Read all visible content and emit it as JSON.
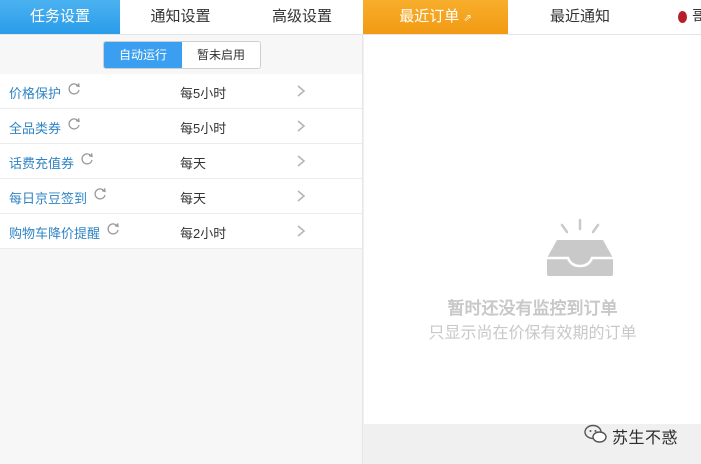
{
  "tabs": [
    {
      "label": "任务设置",
      "state": "active"
    },
    {
      "label": "通知设置",
      "state": "normal"
    },
    {
      "label": "高级设置",
      "state": "normal"
    },
    {
      "label": "最近订单",
      "state": "highlight",
      "icon": "external-link-icon"
    },
    {
      "label": "最近通知",
      "state": "normal"
    },
    {
      "label": "哥",
      "state": "clipped",
      "icon": "red-dot-icon"
    }
  ],
  "mode_toggle": {
    "options": [
      "自动运行",
      "暂未启用"
    ],
    "selected": "自动运行"
  },
  "tasks": [
    {
      "name": "价格保护",
      "frequency": "每5小时",
      "icon": "refresh-icon"
    },
    {
      "name": "全品类券",
      "frequency": "每5小时",
      "icon": "refresh-icon"
    },
    {
      "name": "话费充值券",
      "frequency": "每天",
      "icon": "refresh-icon"
    },
    {
      "name": "每日京豆签到",
      "frequency": "每天",
      "icon": "refresh-icon"
    },
    {
      "name": "购物车降价提醒",
      "frequency": "每2小时",
      "icon": "refresh-icon"
    }
  ],
  "empty_state": {
    "icon": "empty-tray-icon",
    "title": "暂时还没有监控到订单",
    "subtitle": "只显示尚在价保有效期的订单"
  },
  "watermark": {
    "icon": "wechat-icon",
    "text": "苏生不惑"
  },
  "colors": {
    "active_tab": "#2a9ce9",
    "highlight_tab": "#f29a13",
    "link": "#2f84c4",
    "toggle_on": "#3a9ff0"
  }
}
